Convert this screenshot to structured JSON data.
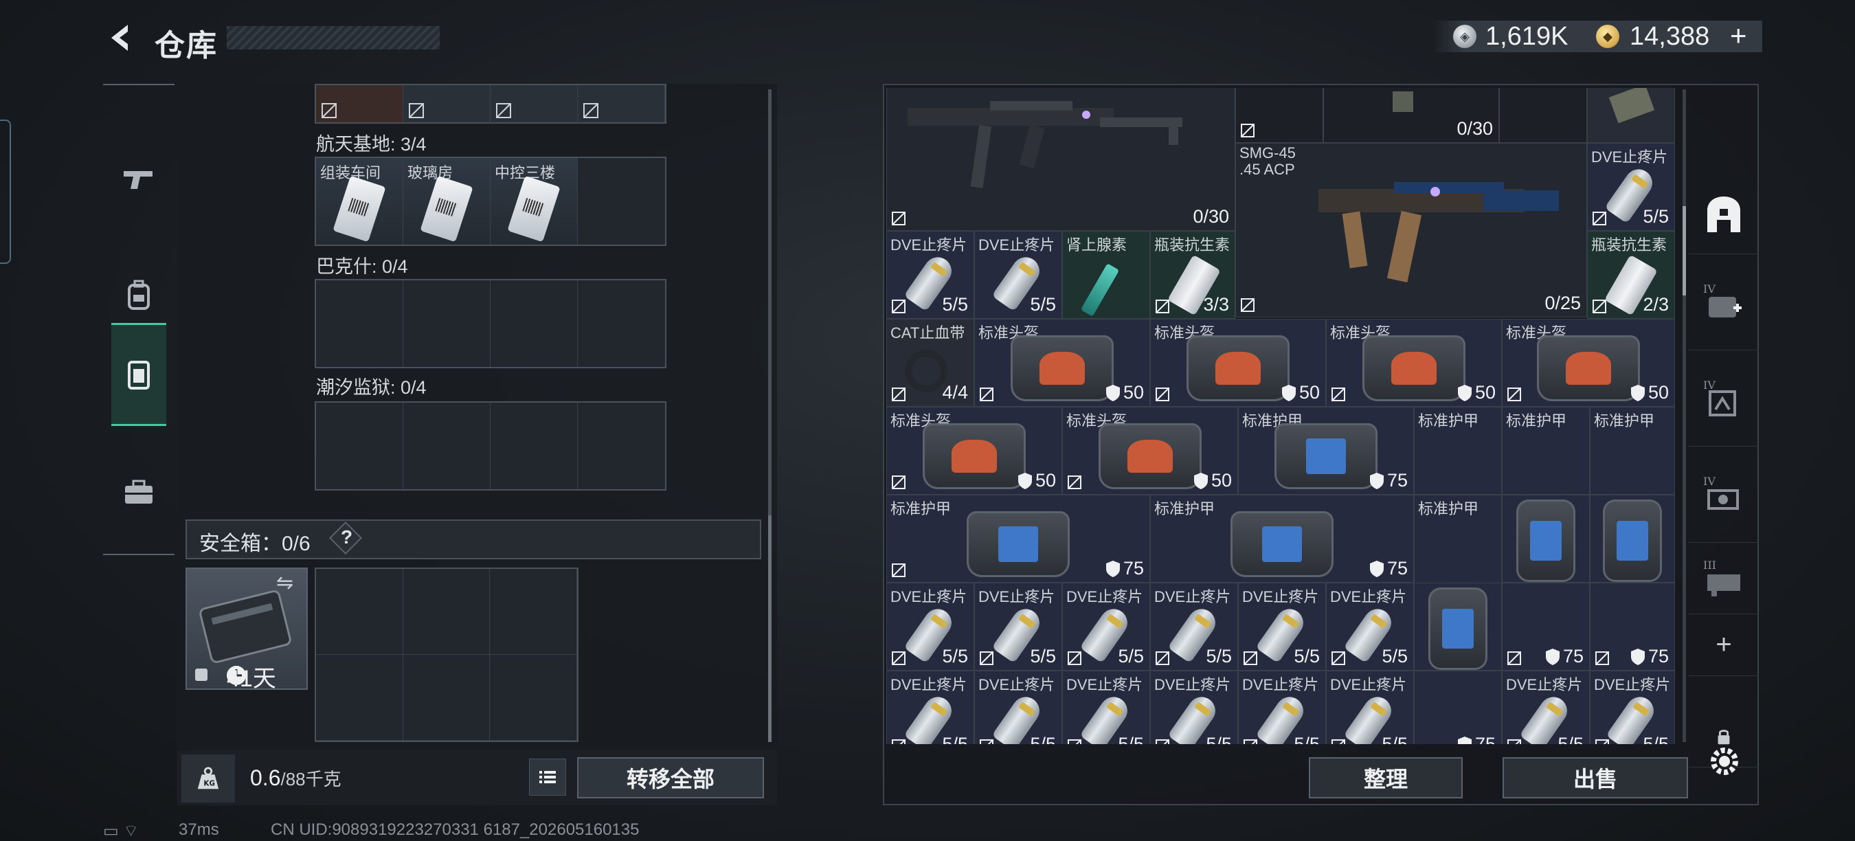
{
  "header": {
    "title": "仓库",
    "silver_amount": "1,619K",
    "gold_amount": "14,388",
    "plus_label": "+"
  },
  "keycards": {
    "aerospace_label": "航天基地: 3/4",
    "aerospace_cards": [
      "组装车间",
      "玻璃房",
      "中控三楼",
      ""
    ],
    "bakesh_label": "巴克什: 0/4",
    "prison_label": "潮汐监狱: 0/4"
  },
  "safe_box": {
    "label": "安全箱：0/6",
    "help": "?",
    "days": "41天"
  },
  "weight": {
    "current": "0.6",
    "capacity": "/88千克"
  },
  "buttons": {
    "transfer_all": "转移全部",
    "sort": "整理",
    "sell": "出售"
  },
  "status": {
    "ping": "37ms",
    "uid": "CN UID:9089319223270331 6187_202605160135"
  },
  "warehouse": {
    "items": [
      {
        "id": "gun1-qty",
        "name": "",
        "qty": "0/30"
      },
      {
        "id": "mag-qty",
        "name": "",
        "qty": "0/30"
      },
      {
        "id": "smg45",
        "name": "SMG-45\n.45 ACP",
        "qty": "0/25"
      },
      {
        "id": "dve-top",
        "name": "DVE止疼片",
        "qty": "5/5"
      },
      {
        "id": "dve1",
        "name": "DVE止疼片",
        "qty": "5/5"
      },
      {
        "id": "dve2",
        "name": "DVE止疼片",
        "qty": "5/5"
      },
      {
        "id": "adrenaline",
        "name": "肾上腺素",
        "qty": ""
      },
      {
        "id": "antibiotic1",
        "name": "瓶装抗生素",
        "qty": "3/3"
      },
      {
        "id": "antibiotic2",
        "name": "瓶装抗生素",
        "qty": "2/3"
      },
      {
        "id": "cat",
        "name": "CAT止血带",
        "qty": "4/4"
      }
    ],
    "helmet_name": "标准头盔",
    "armor_name": "标准护甲",
    "dve_name": "DVE止疼片",
    "dve_qty": "5/5",
    "helmet_dur": "50",
    "armor_dur": "75"
  },
  "colors": {
    "accent": "#45c9a0",
    "helmet_visor": "#c85a3a",
    "armor_plate": "#3f78c8"
  }
}
